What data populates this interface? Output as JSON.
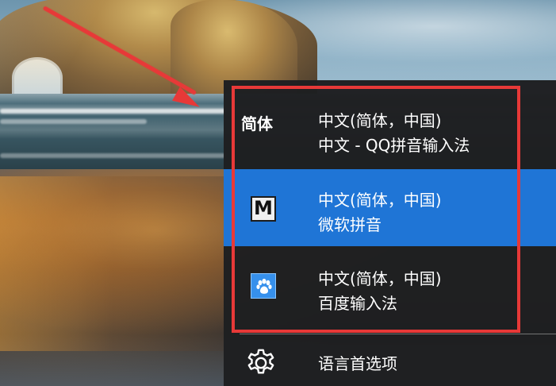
{
  "colors": {
    "flyout_background": "#1e1f22",
    "selected_background": "#1f75d6",
    "annotation_red": "#e73938",
    "text": "#ffffff"
  },
  "language_menu": {
    "options": [
      {
        "short_label": "简体",
        "language": "中文(简体，中国)",
        "input_method": "中文 - QQ拼音输入法",
        "icon": "simplified-chinese-label",
        "selected": false
      },
      {
        "icon_text": "M",
        "language": "中文(简体，中国)",
        "input_method": "微软拼音",
        "icon": "microsoft-pinyin-icon",
        "selected": true
      },
      {
        "language": "中文(简体，中国)",
        "input_method": "百度输入法",
        "icon": "baidu-paw-icon",
        "selected": false
      }
    ],
    "settings": {
      "label": "语言首选项",
      "icon": "gear-icon"
    }
  },
  "annotations": {
    "arrow": "red-arrow",
    "box": "red-highlight-box"
  }
}
